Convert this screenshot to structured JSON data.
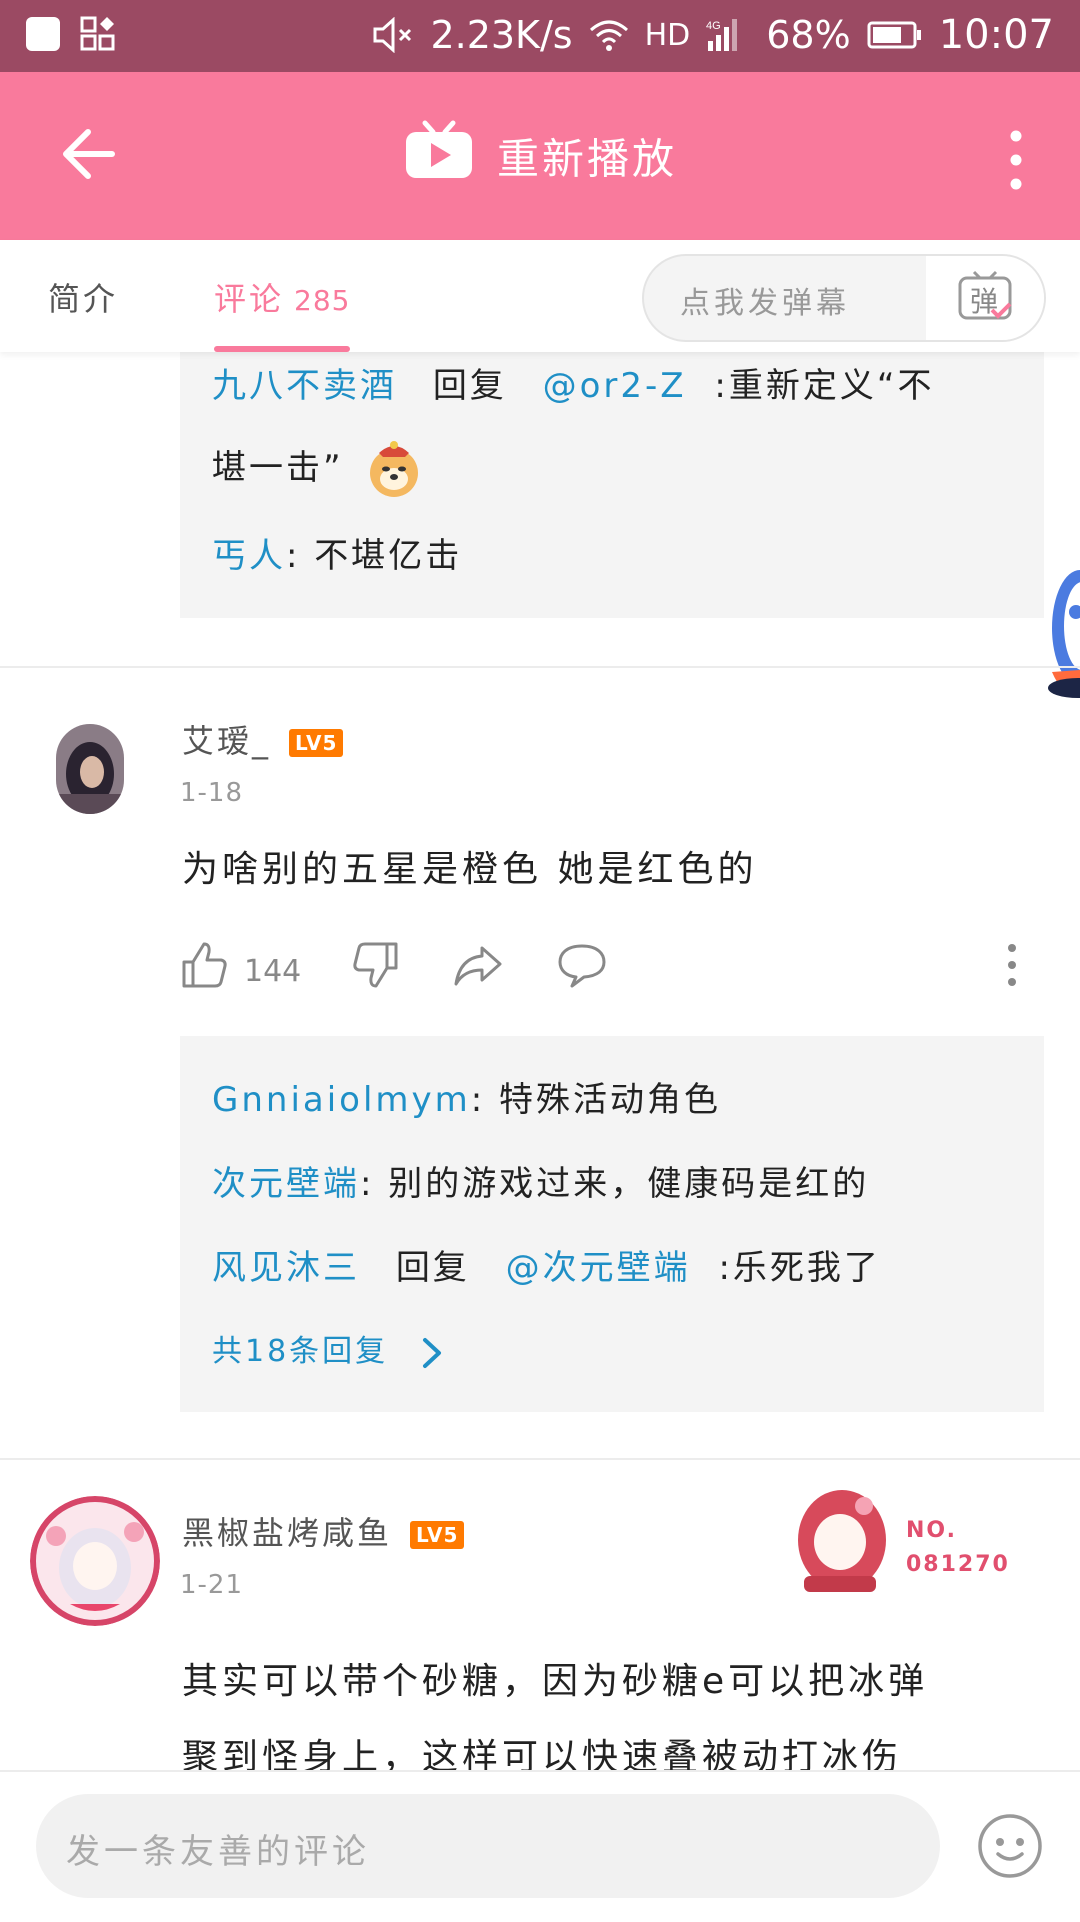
{
  "status_bar": {
    "speed": "2.23K/s",
    "network": "HD",
    "battery": "68%",
    "time": "10:07"
  },
  "app_bar": {
    "title": "重新播放"
  },
  "tabs": {
    "intro": "简介",
    "comments": "评论",
    "comments_count": "285"
  },
  "danmaku": {
    "placeholder": "点我发弹幕",
    "button_label": "弹"
  },
  "top_replies": {
    "line1_user": "九八不卖酒",
    "line1_reply_word": "回复",
    "line1_mention": "@or2-Z",
    "line1_text": ":重新定义“不",
    "line2_text": "堪一击”",
    "line3_user": "丐人",
    "line3_text": ": 不堪亿击"
  },
  "comment1": {
    "username": "艾瑷_",
    "level": "LV5",
    "date": "1-18",
    "text": "为啥别的五星是橙色 她是红色的",
    "likes": "144",
    "replies": [
      {
        "user": "Gnniaiolmym",
        "text": ": 特殊活动角色"
      },
      {
        "user": "次元壁端",
        "text": ": 别的游戏过来，健康码是红的"
      },
      {
        "user": "风见沐三",
        "reply_word": "回复",
        "mention": "@次元壁端",
        "text": ":乐死我了"
      }
    ],
    "more_replies": "共18条回复"
  },
  "comment2": {
    "username": "黑椒盐烤咸鱼",
    "level": "LV5",
    "date": "1-21",
    "badge_no": "NO.",
    "badge_num": "081270",
    "text_line1": "其实可以带个砂糖，因为砂糖e可以把冰弹",
    "text_line2": "聚到怪身上，这样可以快速叠被动打冰伤"
  },
  "bottom": {
    "placeholder": "发一条友善的评论"
  }
}
